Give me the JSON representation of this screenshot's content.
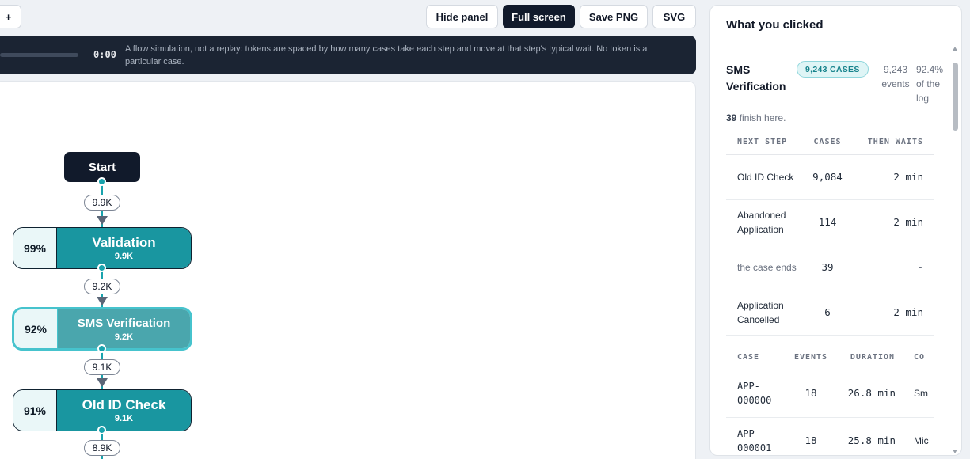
{
  "toolbar": {
    "plus_label": "+",
    "hide_panel_label": "Hide panel",
    "full_screen_label": "Full screen",
    "save_png_label": "Save PNG",
    "svg_label": "SVG"
  },
  "playback": {
    "time": "0:00",
    "note": "A flow simulation, not a replay: tokens are spaced by how many cases take each step and move at that step's typical wait. No token is a particular case."
  },
  "flow": {
    "start_label": "Start",
    "connectors": [
      "9.9K",
      "9.2K",
      "9.1K",
      "8.9K"
    ],
    "steps": [
      {
        "pct": "99%",
        "name": "Validation",
        "count": "9.9K"
      },
      {
        "pct": "92%",
        "name": "SMS Verification",
        "count": "9.2K"
      },
      {
        "pct": "91%",
        "name": "Old ID Check",
        "count": "9.1K"
      }
    ]
  },
  "panel": {
    "title": "What you clicked",
    "node_name": "SMS Verification",
    "cases_badge": "9,243 CASES",
    "events": "9,243 events",
    "share": "92.4% of the log",
    "finish_count": "39",
    "finish_text": "finish here.",
    "next_headers": [
      "NEXT STEP",
      "CASES",
      "THEN WAITS"
    ],
    "next_rows": [
      {
        "step": "Old ID Check",
        "cases": "9,084",
        "wait": "2 min"
      },
      {
        "step": "Abandoned Application",
        "cases": "114",
        "wait": "2 min"
      },
      {
        "step": "the case ends",
        "cases": "39",
        "wait": "-"
      },
      {
        "step": "Application Cancelled",
        "cases": "6",
        "wait": "2 min"
      }
    ],
    "case_headers": [
      "CASE",
      "EVENTS",
      "DURATION",
      "CO"
    ],
    "case_rows": [
      {
        "case": "APP-000000",
        "events": "18",
        "duration": "26.8 min",
        "co": "Sm"
      },
      {
        "case": "APP-000001",
        "events": "18",
        "duration": "25.8 min",
        "co": "Mic"
      }
    ]
  },
  "colors": {
    "accent_teal": "#1996a0",
    "selected_border": "#46c3cd",
    "dark_navy": "#111a2b"
  }
}
